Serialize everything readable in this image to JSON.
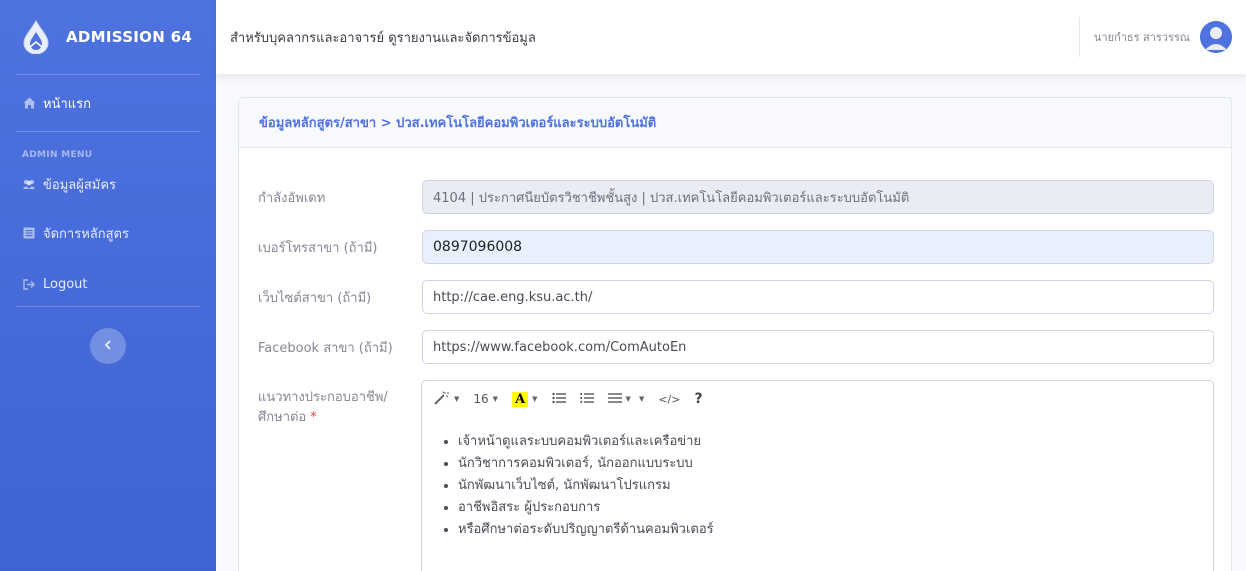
{
  "sidebar": {
    "brand": "ADMISSION 64",
    "home": "หน้าแรก",
    "heading": "ADMIN MENU",
    "items": [
      {
        "label": "ข้อมูลผู้สมัคร",
        "icon": "users-icon"
      },
      {
        "label": "จัดการหลักสูตร",
        "icon": "list-icon"
      },
      {
        "label": "Logout",
        "icon": "logout-icon"
      }
    ],
    "toggle_icon": "chevron-left-icon"
  },
  "topbar": {
    "title": "สำหรับบุคลากรและอาจารย์ ดูรายงานและจัดการข้อมูล",
    "user": "นายกำธร สารวรรณ"
  },
  "card": {
    "header": "ข้อมูลหลักสูตร/สาขา > ปวส.เทคโนโลยีคอมพิวเตอร์และระบบอัตโนมัติ",
    "fields": {
      "updating": {
        "label": "กำลังอัพเดท",
        "value": "4104 | ประกาศนียบัตรวิชาชีพชั้นสูง | ปวส.เทคโนโลยีคอมพิวเตอร์และระบบอัตโนมัติ"
      },
      "phone": {
        "label": "เบอร์โทรสาขา (ถ้ามี)",
        "value": "0897096008"
      },
      "website": {
        "label": "เว็บไซต์สาขา (ถ้ามี)",
        "value": "http://cae.eng.ksu.ac.th/"
      },
      "facebook": {
        "label": "Facebook สาขา (ถ้ามี)",
        "value": "https://www.facebook.com/ComAutoEn"
      },
      "career": {
        "label_line1": "แนวทางประกอบอาชีพ/",
        "label_line2": "ศึกษาต่อ",
        "required_mark": "*"
      }
    },
    "editor": {
      "font_size": "16",
      "font_color_letter": "A",
      "code_label": "</>",
      "help_label": "?",
      "items": [
        "เจ้าหน้าดูแลระบบคอมพิวเตอร์และเครือข่าย",
        "นักวิชาการคอมพิวเตอร์, นักออกแบบระบบ",
        "นักพัฒนาเว็บไซต์, นักพัฒนาโปรแกรม",
        "อาชีพอิสระ ผู้ประกอบการ",
        "หรือศึกษาต่อระดับปริญญาตรีด้านคอมพิวเตอร์"
      ]
    }
  },
  "colors": {
    "primary": "#4e73df",
    "required": "#e74a3b"
  }
}
